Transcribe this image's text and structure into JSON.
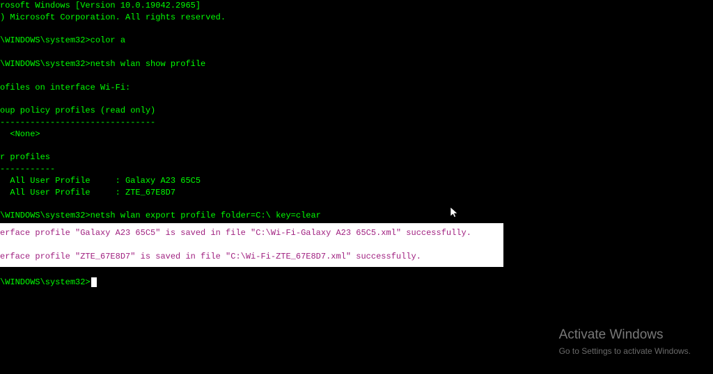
{
  "lines": {
    "l1": "rosoft Windows [Version 10.0.19042.2965]",
    "l2": ") Microsoft Corporation. All rights reserved.",
    "l3": "\\WINDOWS\\system32>color a",
    "l4": "\\WINDOWS\\system32>netsh wlan show profile",
    "l5": "ofiles on interface Wi-Fi:",
    "l6": "oup policy profiles (read only)",
    "l7": "-------------------------------",
    "l8": "  <None>",
    "l9": "r profiles",
    "l10": "-----------",
    "l11": "  All User Profile     : Galaxy A23 65C5",
    "l12": "  All User Profile     : ZTE_67E8D7",
    "l13": "\\WINDOWS\\system32>netsh wlan export profile folder=C:\\ key=clear",
    "l14": "erface profile \"Galaxy A23 65C5\" is saved in file \"C:\\Wi-Fi-Galaxy A23 65C5.xml\" successfully.",
    "l15": "erface profile \"ZTE_67E8D7\" is saved in file \"C:\\Wi-Fi-ZTE_67E8D7.xml\" successfully.",
    "l16": "\\WINDOWS\\system32>"
  },
  "watermark": {
    "title": "Activate Windows",
    "subtitle": "Go to Settings to activate Windows."
  },
  "colors": {
    "terminal_fg": "#00ff00",
    "terminal_bg": "#000000",
    "highlight_bg": "#ffffff",
    "highlight_fg": "#a02080"
  },
  "commands": [
    {
      "prompt": "\\WINDOWS\\system32>",
      "cmd": "color a"
    },
    {
      "prompt": "\\WINDOWS\\system32>",
      "cmd": "netsh wlan show profile"
    },
    {
      "prompt": "\\WINDOWS\\system32>",
      "cmd": "netsh wlan export profile folder=C:\\ key=clear"
    }
  ],
  "profiles": [
    {
      "label": "All User Profile",
      "name": "Galaxy A23 65C5"
    },
    {
      "label": "All User Profile",
      "name": "ZTE_67E8D7"
    }
  ],
  "exported_profiles": [
    {
      "profile": "Galaxy A23 65C5",
      "file": "C:\\Wi-Fi-Galaxy A23 65C5.xml"
    },
    {
      "profile": "ZTE_67E8D7",
      "file": "C:\\Wi-Fi-ZTE_67E8D7.xml"
    }
  ]
}
